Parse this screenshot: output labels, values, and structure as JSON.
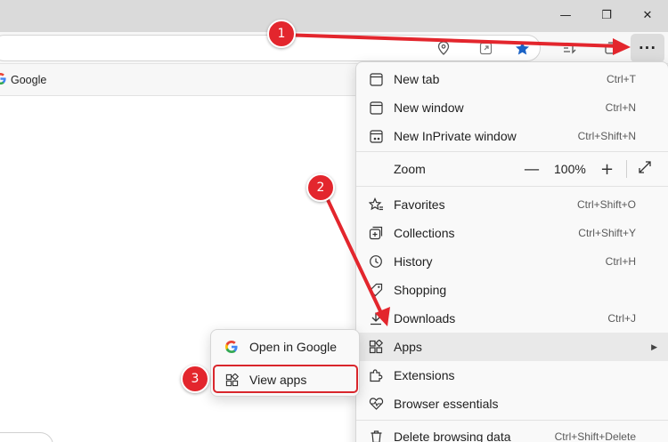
{
  "window_controls": {
    "minimize": "—",
    "maximize": "❐",
    "close": "✕"
  },
  "toolbar": {
    "more_button": "···"
  },
  "favorites_bar": {
    "items": [
      {
        "label": "Google",
        "icon": "google-logo"
      }
    ]
  },
  "menu": {
    "new_tab": {
      "label": "New tab",
      "shortcut": "Ctrl+T"
    },
    "new_window": {
      "label": "New window",
      "shortcut": "Ctrl+N"
    },
    "new_inprivate": {
      "label": "New InPrivate window",
      "shortcut": "Ctrl+Shift+N"
    },
    "zoom": {
      "label": "Zoom",
      "minus": "—",
      "value": "100%",
      "plus": "+"
    },
    "favorites": {
      "label": "Favorites",
      "shortcut": "Ctrl+Shift+O"
    },
    "collections": {
      "label": "Collections",
      "shortcut": "Ctrl+Shift+Y"
    },
    "history": {
      "label": "History",
      "shortcut": "Ctrl+H"
    },
    "shopping": {
      "label": "Shopping"
    },
    "downloads": {
      "label": "Downloads",
      "shortcut": "Ctrl+J"
    },
    "apps": {
      "label": "Apps"
    },
    "extensions": {
      "label": "Extensions"
    },
    "browser_essentials": {
      "label": "Browser essentials"
    },
    "delete_browsing_data": {
      "label": "Delete browsing data",
      "shortcut": "Ctrl+Shift+Delete"
    }
  },
  "apps_submenu": {
    "open_in_google": {
      "label": "Open in Google"
    },
    "view_apps": {
      "label": "View apps"
    }
  },
  "annotations": {
    "steps": [
      {
        "number": "1"
      },
      {
        "number": "2"
      },
      {
        "number": "3"
      }
    ],
    "color": "#e3262d"
  }
}
